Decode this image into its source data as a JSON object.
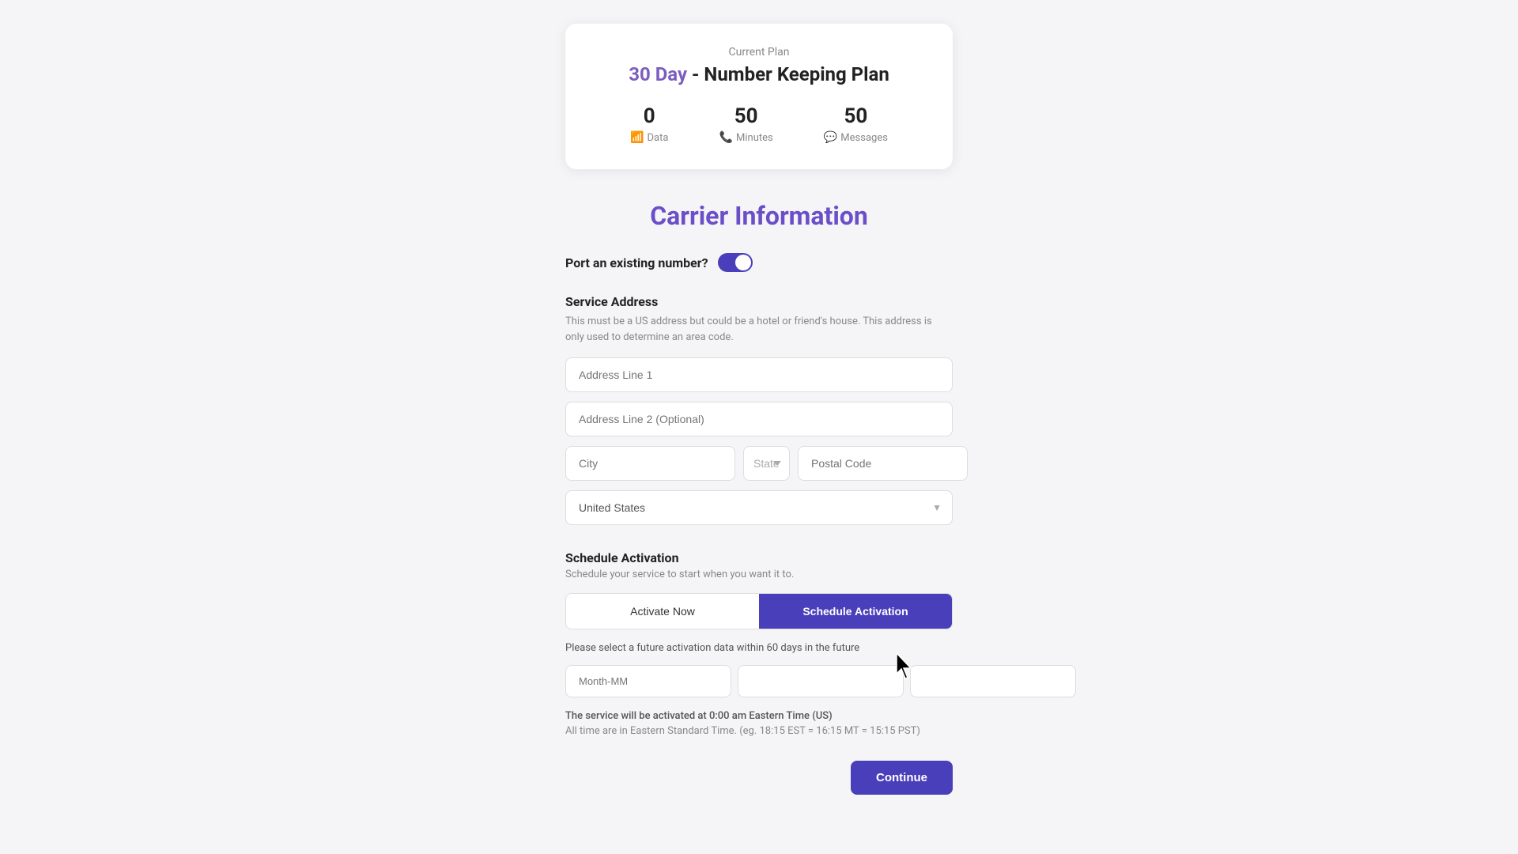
{
  "plan": {
    "label": "Current Plan",
    "title_highlight": "30 Day",
    "title_rest": " - Number Keeping Plan",
    "stats": [
      {
        "value": "0",
        "label": "Data",
        "icon": "wifi"
      },
      {
        "value": "50",
        "label": "Minutes",
        "icon": "phone"
      },
      {
        "value": "50",
        "label": "Messages",
        "icon": "msg"
      }
    ]
  },
  "carrier_section": {
    "title": "Carrier Information",
    "port_label": "Port an existing number?",
    "service_address": {
      "header": "Service Address",
      "description": "This must be a US address but could be a hotel or friend's house. This address is only used to determine an area code.",
      "address1_placeholder": "Address Line 1",
      "address2_placeholder": "Address Line 2 (Optional)",
      "city_placeholder": "City",
      "state_placeholder": "State",
      "postal_placeholder": "Postal Code",
      "country_value": "United States"
    },
    "schedule": {
      "header": "Schedule Activation",
      "description": "Schedule your service to start when you want it to.",
      "activate_now_label": "Activate Now",
      "schedule_label": "Schedule Activation",
      "hint": "Please select a future activation data within 60 days in the future",
      "month_placeholder": "Month-MM",
      "day_placeholder": "",
      "year_placeholder": "",
      "time_note": "The service will be activated at 0:00 am Eastern Time (US)",
      "time_note_sub": "All time are in Eastern Standard Time. (eg. 18:15 EST = 16:15 MT = 15:15 PST)"
    },
    "continue_label": "Continue"
  }
}
